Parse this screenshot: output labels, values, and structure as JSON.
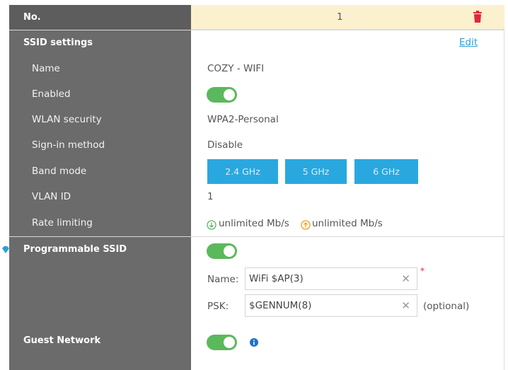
{
  "header": {
    "no_label": "No.",
    "no_value": "1",
    "delete_icon": "trash-icon"
  },
  "ssid_settings": {
    "section_label": "SSID settings",
    "edit_label": "Edit",
    "rows": {
      "name": {
        "label": "Name",
        "value": "COZY - WIFI"
      },
      "enabled": {
        "label": "Enabled",
        "value": true
      },
      "wlan_security": {
        "label": "WLAN security",
        "value": "WPA2-Personal"
      },
      "sign_in": {
        "label": "Sign-in method",
        "value": "Disable"
      },
      "band_mode": {
        "label": "Band mode",
        "bands": [
          "2.4 GHz",
          "5 GHz",
          "6 GHz"
        ]
      },
      "vlan_id": {
        "label": "VLAN ID",
        "value": "1"
      },
      "rate_limiting": {
        "label": "Rate limiting",
        "down": "unlimited Mb/s",
        "up": "unlimited Mb/s"
      }
    }
  },
  "programmable_ssid": {
    "label": "Programmable SSID",
    "enabled": true,
    "name_label": "Name:",
    "name_value": "WiFi $AP(3)",
    "required_mark": "*",
    "psk_label": "PSK:",
    "psk_value": "$GENNUM(8)",
    "optional_label": "(optional)"
  },
  "guest_network": {
    "label": "Guest Network",
    "enabled": true,
    "info_icon": "info-icon"
  },
  "colors": {
    "toggle_on": "#5cb85c",
    "band_button": "#29a8e0",
    "link": "#2a9fd8",
    "delete": "#e0283a",
    "header_bg": "#fbf1cf",
    "label_bg": "#6b6b6b"
  }
}
